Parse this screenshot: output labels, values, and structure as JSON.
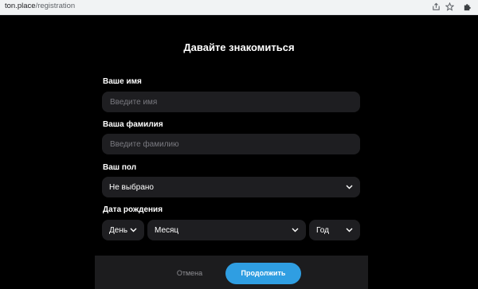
{
  "browser": {
    "url_host": "ton.place",
    "url_path": "/registration",
    "icons": [
      "share-icon",
      "star-icon",
      "extensions-icon"
    ]
  },
  "form": {
    "title": "Давайте знакомиться",
    "first_name": {
      "label": "Ваше имя",
      "placeholder": "Введите имя",
      "value": ""
    },
    "last_name": {
      "label": "Ваша фамилия",
      "placeholder": "Введите фамилию",
      "value": ""
    },
    "gender": {
      "label": "Ваш пол",
      "selected": "Не выбрано"
    },
    "birthdate": {
      "label": "Дата рождения",
      "day": "День",
      "month": "Месяц",
      "year": "Год"
    }
  },
  "footer": {
    "cancel_label": "Отмена",
    "continue_label": "Продолжить"
  },
  "colors": {
    "background": "#000000",
    "field": "#1e1e21",
    "footer": "#1c1c1e",
    "accent": "#2f9ee2"
  }
}
